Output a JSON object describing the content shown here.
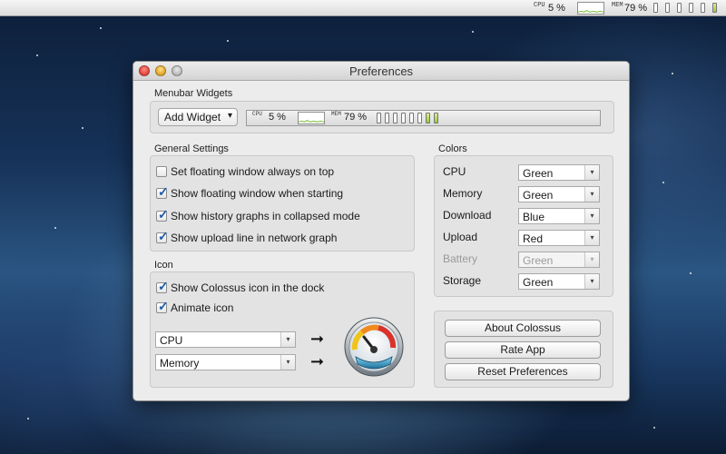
{
  "menubar": {
    "cpu_label": "CPU",
    "cpu_value": "5 %",
    "mem_label": "MEM",
    "mem_value": "79 %",
    "battery_cells": 6,
    "battery_filled": 1
  },
  "window": {
    "title": "Preferences"
  },
  "menubar_widgets": {
    "section_title": "Menubar Widgets",
    "add_widget_label": "Add Widget",
    "add_widget_arrow": "▾",
    "preview_cpu_label": "CPU",
    "preview_cpu_value": "5 %",
    "preview_mem_label": "MEM",
    "preview_mem_value": "79 %"
  },
  "general_settings": {
    "section_title": "General Settings",
    "options": [
      {
        "label": "Set floating window always on top",
        "checked": false
      },
      {
        "label": "Show floating window when starting",
        "checked": true
      },
      {
        "label": "Show history graphs in collapsed mode",
        "checked": true
      },
      {
        "label": "Show upload line in network graph",
        "checked": true
      }
    ]
  },
  "icon_section": {
    "section_title": "Icon",
    "options": [
      {
        "label": "Show Colossus icon in the dock",
        "checked": true
      },
      {
        "label": "Animate icon",
        "checked": true
      }
    ],
    "selects": [
      {
        "value": "CPU"
      },
      {
        "value": "Memory"
      }
    ],
    "arrow_glyph": "➞"
  },
  "colors": {
    "section_title": "Colors",
    "rows": [
      {
        "label": "CPU",
        "value": "Green",
        "enabled": true
      },
      {
        "label": "Memory",
        "value": "Green",
        "enabled": true
      },
      {
        "label": "Download",
        "value": "Blue",
        "enabled": true
      },
      {
        "label": "Upload",
        "value": "Red",
        "enabled": true
      },
      {
        "label": "Battery",
        "value": "Green",
        "enabled": false
      },
      {
        "label": "Storage",
        "value": "Green",
        "enabled": true
      }
    ]
  },
  "buttons": {
    "about": "About Colossus",
    "rate": "Rate App",
    "reset": "Reset Preferences"
  },
  "icons": {
    "close": "close-icon",
    "minimize": "minimize-icon",
    "zoom": "zoom-icon",
    "gauge": "gauge-icon",
    "select_arrow": "▾"
  },
  "palette": {
    "graph_green": "#7cc23a",
    "select_arrow_color": "#444444"
  }
}
